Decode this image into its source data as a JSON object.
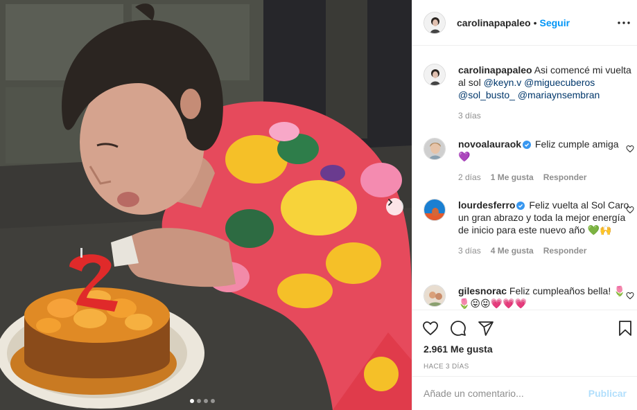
{
  "header": {
    "username": "carolinapapaleo",
    "separator": "•",
    "follow_label": "Seguir"
  },
  "caption": {
    "username": "carolinapapaleo",
    "text": " Asi comencé mi vuelta al sol ",
    "mentions": [
      "@keyn.v",
      "@miguecuberos",
      "@sol_busto_",
      "@mariaynsembran"
    ],
    "time": "3 días"
  },
  "comments": [
    {
      "username": "novoalauraok",
      "verified": true,
      "text": " Feliz cumple amiga 💜",
      "time": "2 días",
      "likes": "1 Me gusta",
      "reply": "Responder"
    },
    {
      "username": "lourdesferro",
      "verified": true,
      "text": " Feliz vuelta al Sol Caro un gran abrazo y toda la mejor energía de inicio para este nuevo año 💚🙌",
      "time": "3 días",
      "likes": "4 Me gusta",
      "reply": "Responder"
    },
    {
      "username": "gilesnorac",
      "verified": false,
      "text": " Feliz cumpleaños bella! 🌷🌷😝😝💗💗💗"
    }
  ],
  "likes_count": "2.961 Me gusta",
  "posted_ago": "HACE 3 DÍAS",
  "comment_box": {
    "placeholder": "Añade un comentario...",
    "publish_label": "Publicar"
  },
  "carousel": {
    "current": 1,
    "total": 4
  },
  "colors": {
    "link": "#0095f6",
    "mention": "#00376b",
    "muted": "#8e8e8e",
    "publish_disabled": "#b2dffc",
    "verified": "#3897f0"
  },
  "icons": [
    "more-icon",
    "heart-icon",
    "comment-icon",
    "share-icon",
    "bookmark-icon",
    "chevron-right-icon",
    "verified-icon"
  ]
}
